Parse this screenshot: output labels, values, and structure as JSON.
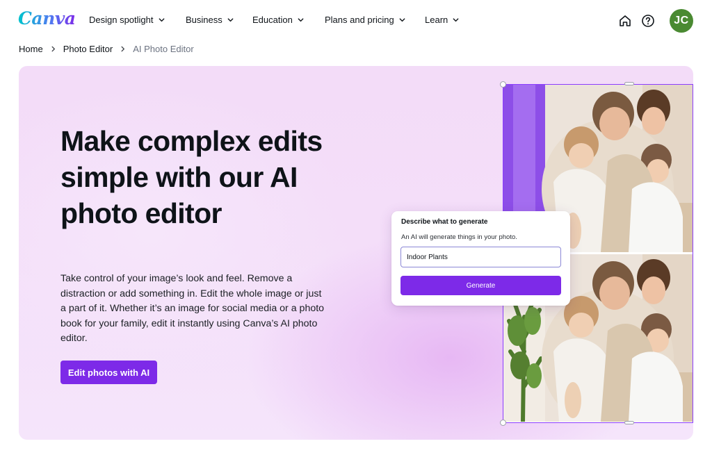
{
  "brand": {
    "logo_text": "Canva",
    "accent": "#7d2ae8"
  },
  "nav": {
    "items": [
      {
        "label": "Design spotlight"
      },
      {
        "label": "Business"
      },
      {
        "label": "Education"
      },
      {
        "label": "Plans and pricing"
      },
      {
        "label": "Learn"
      }
    ],
    "icons": [
      "home-icon",
      "help-icon"
    ],
    "avatar_initials": "JC",
    "avatar_color": "#4a8a32"
  },
  "breadcrumb": {
    "items": [
      "Home",
      "Photo Editor"
    ],
    "current": "AI Photo Editor"
  },
  "hero": {
    "title": "Make complex edits simple with our AI photo editor",
    "description": "Take control of your image’s look and feel. Remove a distraction or add something in. Edit the whole image or just a part of it. Whether it’s an image for social media or a photo book for your family, edit it instantly using Canva’s AI photo editor.",
    "cta_label": "Edit photos with AI"
  },
  "generate_card": {
    "title": "Describe what to generate",
    "subtitle": "An AI will generate things in your photo.",
    "input_value": "Indoor Plants",
    "button_label": "Generate"
  }
}
